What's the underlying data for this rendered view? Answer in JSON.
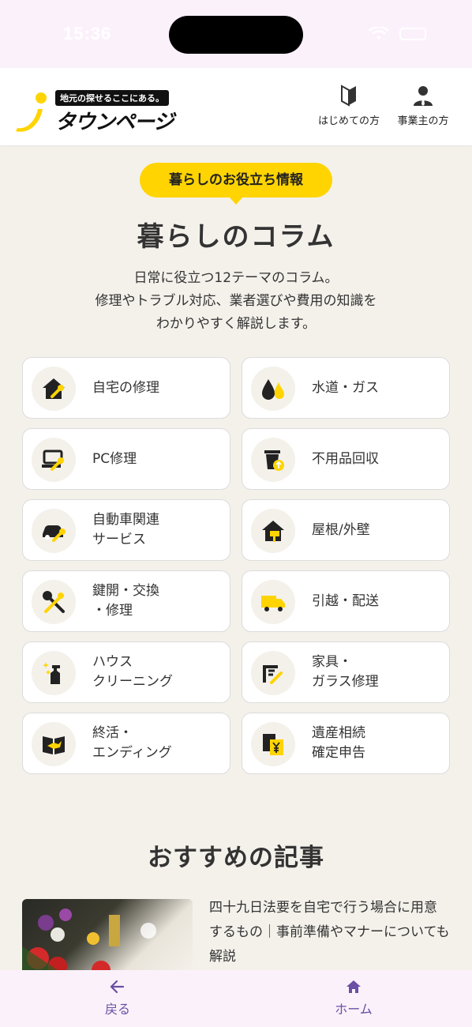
{
  "status_bar": {
    "time": "15:36"
  },
  "header": {
    "logo_tagline": "地元の探せるここにある。",
    "logo_text": "タウンページ",
    "links": [
      {
        "label": "はじめての方",
        "icon": "beginner-mark-icon"
      },
      {
        "label": "事業主の方",
        "icon": "business-person-icon"
      }
    ]
  },
  "badge": "暮らしのお役立ち情報",
  "title": "暮らしのコラム",
  "intro_lines": [
    "日常に役立つ12テーマのコラム。",
    "修理やトラブル対応、業者選びや費用の知識を",
    "わかりやすく解説します。"
  ],
  "categories": [
    {
      "label": "自宅の修理",
      "icon": "house-wrench-icon"
    },
    {
      "label": "水道・ガス",
      "icon": "water-flame-icon"
    },
    {
      "label": "PC修理",
      "icon": "laptop-wrench-icon"
    },
    {
      "label": "不用品回収",
      "icon": "trash-recycle-icon"
    },
    {
      "label": "自動車関連\nサービス",
      "icon": "car-wrench-icon"
    },
    {
      "label": "屋根/外壁",
      "icon": "house-paint-icon"
    },
    {
      "label": "鍵開・交換\n・修理",
      "icon": "key-wrench-icon"
    },
    {
      "label": "引越・配送",
      "icon": "truck-icon"
    },
    {
      "label": "ハウス\nクリーニング",
      "icon": "spray-bottle-icon"
    },
    {
      "label": "家具・\nガラス修理",
      "icon": "furniture-pen-icon"
    },
    {
      "label": "終活・\nエンディング",
      "icon": "book-bird-icon"
    },
    {
      "label": "遺産相続\n確定申告",
      "icon": "yen-document-icon"
    }
  ],
  "section2_title": "おすすめの記事",
  "article": {
    "title": "四十九日法要を自宅で行う場合に用意するもの｜事前準備やマナーについても解説"
  },
  "bottom_nav": {
    "back": "戻る",
    "home": "ホーム"
  },
  "colors": {
    "accent_yellow": "#ffd400",
    "background": "#f4f1eb",
    "nav_purple": "#6a4fa4"
  }
}
